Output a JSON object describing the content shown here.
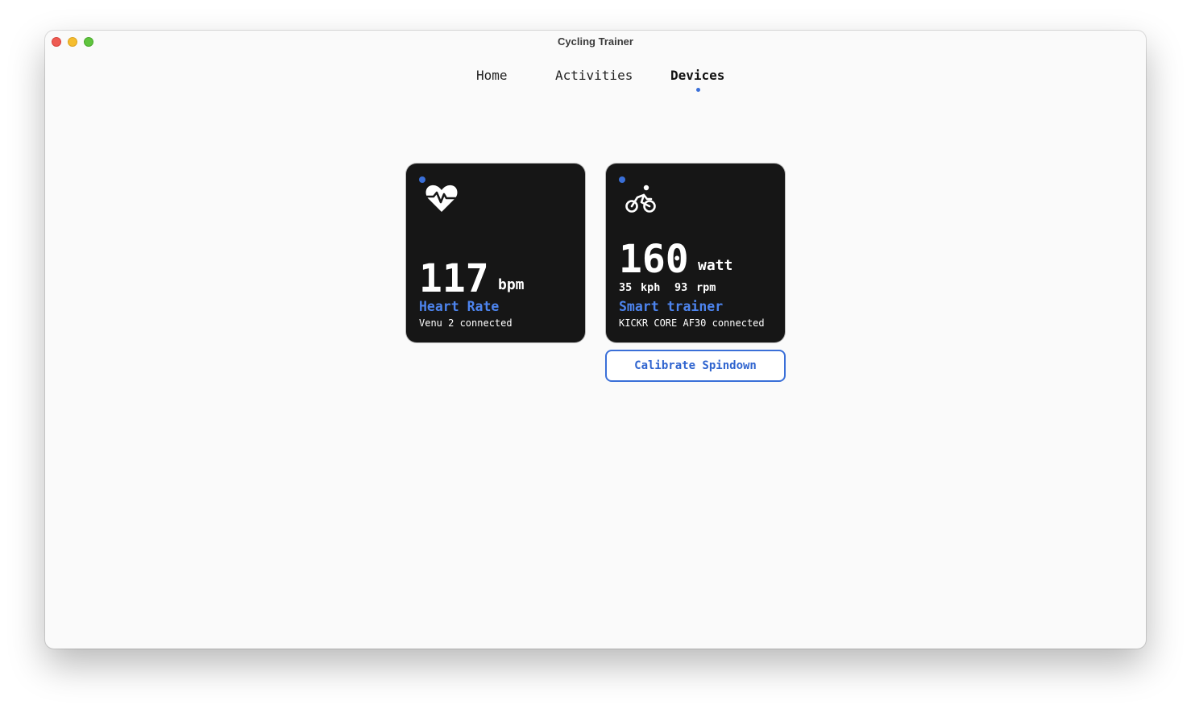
{
  "window": {
    "title": "Cycling Trainer"
  },
  "nav": {
    "tabs": [
      {
        "label": "Home"
      },
      {
        "label": "Activities"
      },
      {
        "label": "Devices"
      }
    ],
    "active_tab": "Devices"
  },
  "devices": {
    "heart_rate": {
      "value": "117",
      "unit": "bpm",
      "type_label": "Heart Rate",
      "status": "Venu 2 connected",
      "icon": "heart-pulse-icon"
    },
    "trainer": {
      "value": "160",
      "unit": "watt",
      "speed_value": "35",
      "speed_unit": "kph",
      "cadence_value": "93",
      "cadence_unit": "rpm",
      "type_label": "Smart trainer",
      "status": "KICKR CORE AF30 connected",
      "icon": "bicycle-icon"
    }
  },
  "actions": {
    "calibrate_label": "Calibrate Spindown"
  },
  "colors": {
    "accent": "#3a6fd8",
    "card_bg": "#161616",
    "window_bg": "#fafafa"
  }
}
